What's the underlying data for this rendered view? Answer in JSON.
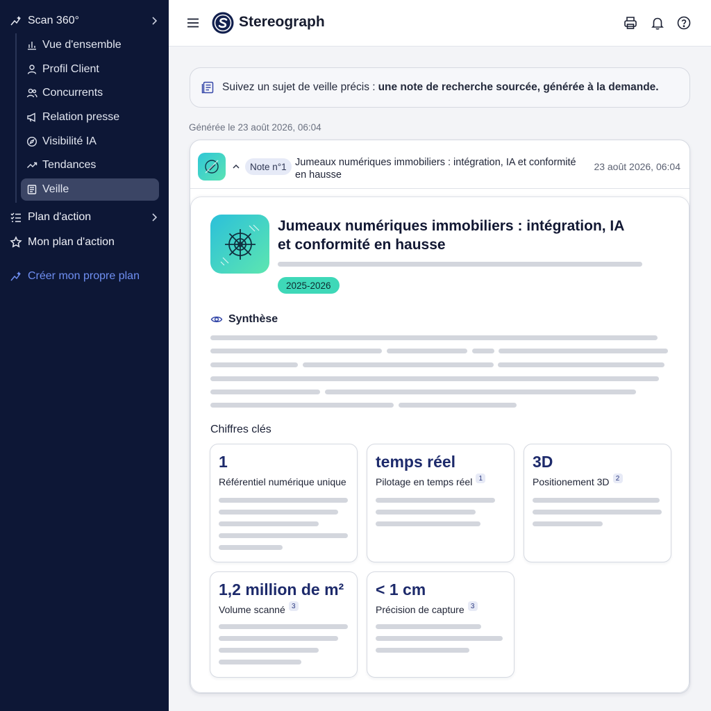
{
  "sidebar": {
    "scan": "Scan 360°",
    "items": [
      {
        "label": "Vue d'ensemble",
        "icon": "bar-chart-icon"
      },
      {
        "label": "Profil Client",
        "icon": "user-icon"
      },
      {
        "label": "Concurrents",
        "icon": "users-icon"
      },
      {
        "label": "Relation presse",
        "icon": "megaphone-icon"
      },
      {
        "label": "Visibilité IA",
        "icon": "compass-icon"
      },
      {
        "label": "Tendances",
        "icon": "trend-icon"
      },
      {
        "label": "Veille",
        "icon": "newspaper-icon",
        "active": true
      }
    ],
    "plan": "Plan d'action",
    "myplan": "Mon plan d'action",
    "create": "Créer mon propre plan",
    "accent": "#6f8ff2"
  },
  "topbar": {
    "brand": "Stereograph"
  },
  "banner": {
    "text": "Suivez un sujet de veille précis :",
    "bold": "une note de recherche sourcée, générée à la demande."
  },
  "generated": "Générée le 23 août 2026, 06:04",
  "note": {
    "badge": "Note n°1",
    "title": "Jumeaux numériques immobiliers : intégration, IA et conformité en hausse",
    "date": "23 août 2026, 06:04",
    "doc_title": "Jumeaux numériques immobiliers : intégration, IA et conformité en hausse",
    "period": "2025-2026",
    "synthese": "Synthèse",
    "key_figures": "Chiffres clés",
    "kpis": [
      {
        "value": "1",
        "label": "Référentiel numérique unique",
        "ref": ""
      },
      {
        "value": "temps réel",
        "label": "Pilotage en temps réel",
        "ref": "1"
      },
      {
        "value": "3D",
        "label": "Positionement 3D",
        "ref": "2"
      },
      {
        "value": "1,2 million de m²",
        "label": "Volume scanné",
        "ref": "3"
      },
      {
        "value": "< 1 cm",
        "label": "Précision de capture",
        "ref": "3"
      }
    ]
  }
}
